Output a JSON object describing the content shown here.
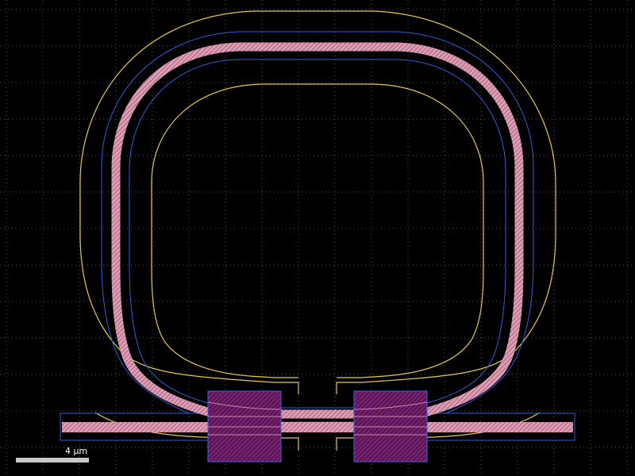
{
  "viewer": {
    "background": "#000000",
    "grid_color": "#8c8c8c"
  },
  "layers": {
    "waveguide": {
      "color": "#e9a0b8",
      "pattern": "hatched"
    },
    "cladding_outline": {
      "color": "#2e5fd6"
    },
    "exclusion_outline": {
      "color": "#e6c84a"
    },
    "heater_pads": {
      "color": "#6e1f68"
    },
    "pad_outline": {
      "color": "#3a63e6"
    }
  },
  "scale_bar": {
    "label": "4 µm"
  }
}
